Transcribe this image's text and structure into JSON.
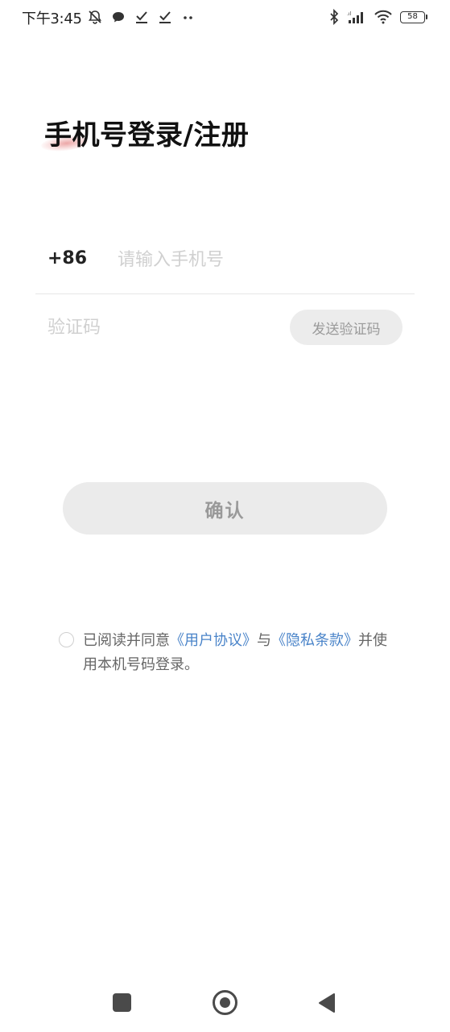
{
  "status_bar": {
    "time": "下午3:45",
    "battery": "58",
    "left_icons": [
      "bell-off-icon",
      "chat-bubble-icon",
      "check-download-icon",
      "check-download-icon",
      "more-dots-icon"
    ],
    "right_icons": [
      "bluetooth-icon",
      "signal-icon",
      "wifi-icon",
      "battery-icon"
    ]
  },
  "title": "手机号登录/注册",
  "phone": {
    "country_code": "+86",
    "placeholder": "请输入手机号",
    "value": ""
  },
  "code": {
    "placeholder": "验证码",
    "value": "",
    "send_button": "发送验证码"
  },
  "confirm_button": "确认",
  "agreement": {
    "checked": false,
    "prefix": "已阅读并同意",
    "link_user": "《用户协议》",
    "middle": "与",
    "link_privacy": "《隐私条款》",
    "suffix": "并使用本机号码登录。"
  },
  "colors": {
    "link": "#4a84c9",
    "button_bg": "#ebebeb",
    "button_text": "#999999",
    "accent_blush": "#e27878"
  }
}
